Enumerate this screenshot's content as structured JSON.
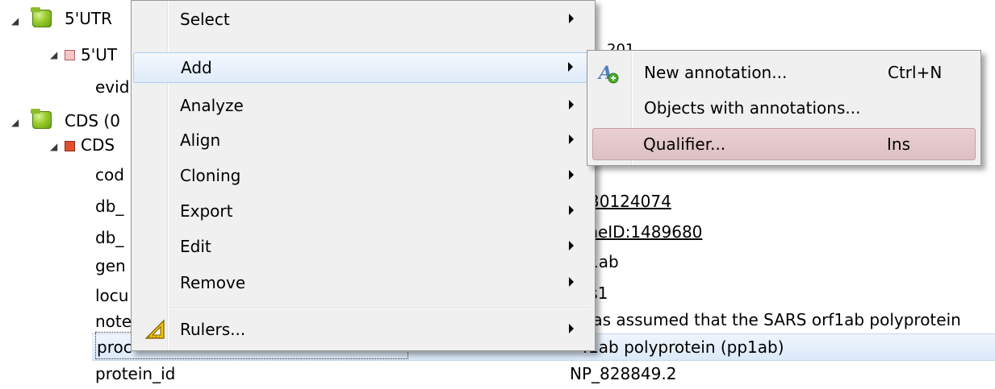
{
  "tree": {
    "rows": [
      {
        "label": "5'UTR",
        "indent": "group"
      },
      {
        "label": "5'UT",
        "indent": "item"
      },
      {
        "label": "evid",
        "indent": "qual"
      },
      {
        "label": "CDS  (0",
        "indent": "group"
      },
      {
        "label": "CDS",
        "indent": "item"
      },
      {
        "label": "cod"
      },
      {
        "label": "db_"
      },
      {
        "label": "db_"
      },
      {
        "label": "gen"
      },
      {
        "label": "locu"
      },
      {
        "label": "note"
      },
      {
        "label": "proc"
      },
      {
        "label": "protein_id"
      }
    ],
    "values": [
      {
        "text": "30124074",
        "underline": true
      },
      {
        "text": "eneID:1489680",
        "underline": true
      },
      {
        "text": "f1ab"
      },
      {
        "text": "rs1"
      },
      {
        "text": "was assumed that the SARS orf1ab polyprotein"
      },
      {
        "text": "f1ab polyprotein (pp1ab)"
      },
      {
        "text": "NP_828849.2"
      }
    ],
    "partial_top": "201"
  },
  "context_menu": {
    "items": [
      {
        "label": "Select",
        "submenu": true
      },
      {
        "label": "Add",
        "submenu": true,
        "highlighted": true
      },
      {
        "label": "Analyze",
        "submenu": true
      },
      {
        "label": "Align",
        "submenu": true
      },
      {
        "label": "Cloning",
        "submenu": true
      },
      {
        "label": "Export",
        "submenu": true
      },
      {
        "label": "Edit",
        "submenu": true
      },
      {
        "label": "Remove",
        "submenu": true
      },
      {
        "label": "Rulers...",
        "submenu": true,
        "icon": "ruler-icon"
      }
    ]
  },
  "add_submenu": {
    "items": [
      {
        "label": "New annotation...",
        "shortcut": "Ctrl+N",
        "icon": "new-annotation-icon"
      },
      {
        "label": "Objects with annotations...",
        "shortcut": ""
      },
      {
        "label": "Qualifier...",
        "shortcut": "Ins",
        "highlighted": true
      }
    ]
  },
  "colors": {
    "menu_bg": "#f0f0f0",
    "highlight": "#dfebf8",
    "highlight_qualifier": "#dcc0c3",
    "folder_green": "#9ccd2e",
    "cds_red": "#e0502e",
    "utr_pink": "#f4c6c8"
  }
}
